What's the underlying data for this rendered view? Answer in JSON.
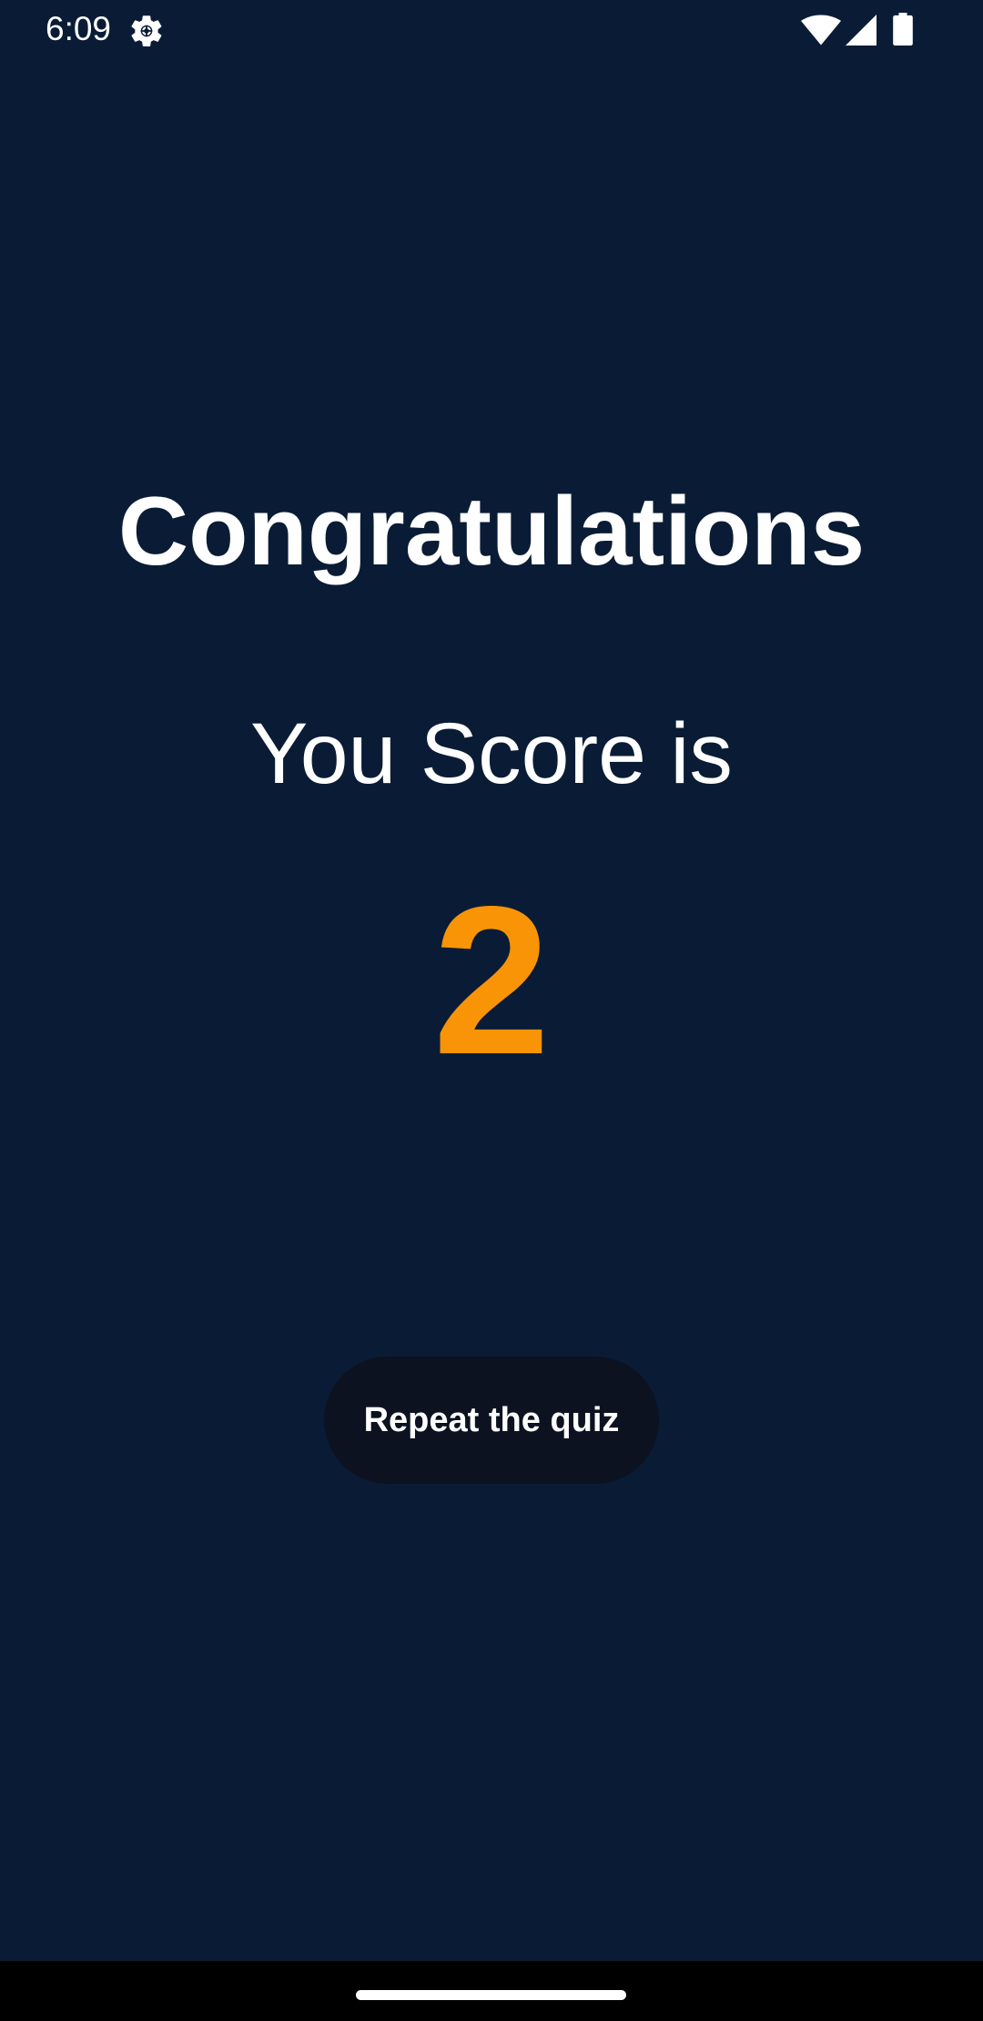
{
  "status_bar": {
    "time": "6:09",
    "icons": [
      "gear-icon",
      "wifi-icon",
      "signal-icon",
      "battery-icon"
    ]
  },
  "result": {
    "title": "Congratulations",
    "subtitle": "You Score is",
    "score": "2"
  },
  "actions": {
    "repeat_label": "Repeat the quiz"
  },
  "colors": {
    "background": "#0a1c35",
    "score_accent": "#f89406",
    "button_background": "#0c1220",
    "text": "#ffffff"
  }
}
